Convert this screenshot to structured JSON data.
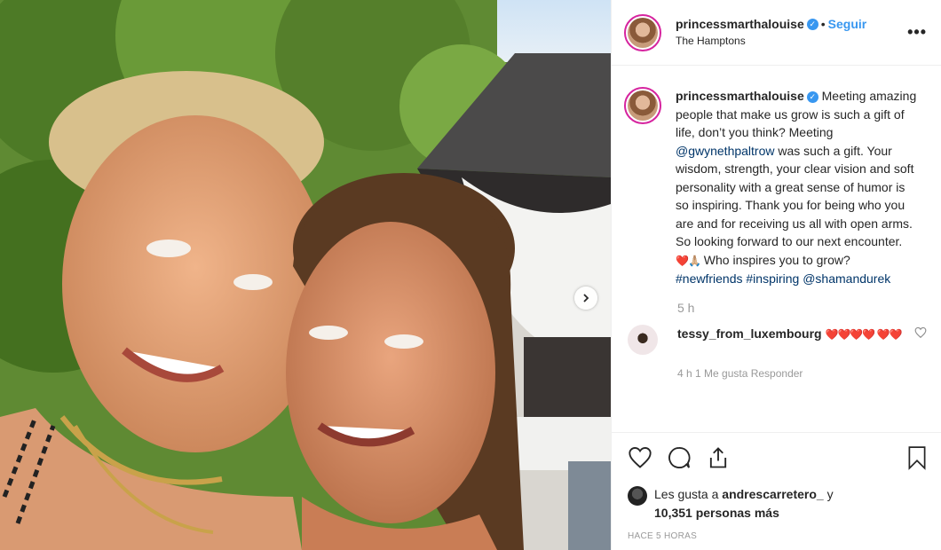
{
  "header": {
    "username": "princessmarthalouise",
    "follow_label": "Seguir",
    "dot": "•",
    "location": "The Hamptons",
    "more_label": "•••",
    "verified_glyph": "✓"
  },
  "caption": {
    "username": "princessmarthalouise",
    "text_1": "Meeting amazing people that make us grow is such a gift of life, don’t you think? Meeting ",
    "mention_1": "@gwynethpaltrow",
    "text_2": " was such a gift. Your wisdom, strength, your clear vision and soft personality with a great sense of humor is so inspiring. Thank you for being who you are and for receiving us all with open arms. So looking forward to our next encounter. ",
    "emoji": "❤️🙏🏼",
    "text_3": " Who inspires you to grow? ",
    "tag_1": "#newfriends",
    "tag_2": "#inspiring",
    "mention_2": "@shamandurek",
    "time": "5 h"
  },
  "comment": {
    "username": "tessy_from_luxembourg",
    "text": "❤️❤️❤️❤️ ❤️❤️",
    "cut_text": "4 h   1 Me gusta   Responder"
  },
  "actions": {
    "like_icon": "heart-outline-icon",
    "comment_icon": "comment-bubble-icon",
    "share_icon": "share-icon",
    "save_icon": "bookmark-icon"
  },
  "likes": {
    "prefix": "Les gusta a ",
    "liker": "andrescarretero_",
    "and": " y ",
    "others": "10,351 personas más"
  },
  "timestamp": "HACE 5 HORAS",
  "colors": {
    "accent": "#3897f0",
    "text": "#262626",
    "muted": "#999999",
    "link": "#003569"
  }
}
